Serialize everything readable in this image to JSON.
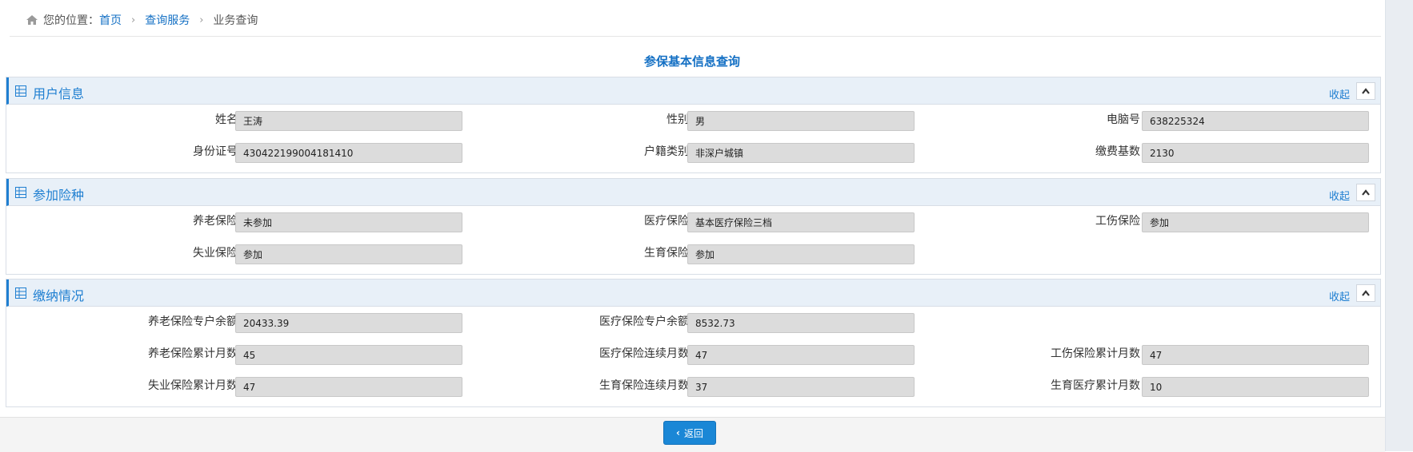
{
  "breadcrumb": {
    "prefix": "您的位置：",
    "home": "首页",
    "service": "查询服务",
    "current": "业务查询"
  },
  "page_title": "参保基本信息查询",
  "panels": {
    "user": {
      "title": "用户信息",
      "collapse": "收起",
      "fields": {
        "name": {
          "label": "姓名",
          "value": "王涛"
        },
        "gender": {
          "label": "性别",
          "value": "男"
        },
        "pc_no": {
          "label": "电脑号",
          "value": "638225324"
        },
        "id_no": {
          "label": "身份证号",
          "value": "430422199004181410"
        },
        "hukou": {
          "label": "户籍类别",
          "value": "非深户城镇"
        },
        "base": {
          "label": "缴费基数",
          "value": "2130"
        }
      }
    },
    "insurance": {
      "title": "参加险种",
      "collapse": "收起",
      "fields": {
        "pension": {
          "label": "养老保险",
          "value": "未参加"
        },
        "medical": {
          "label": "医疗保险",
          "value": "基本医疗保险三档"
        },
        "injury": {
          "label": "工伤保险",
          "value": "参加"
        },
        "unemployment": {
          "label": "失业保险",
          "value": "参加"
        },
        "maternity": {
          "label": "生育保险",
          "value": "参加"
        }
      }
    },
    "payment": {
      "title": "缴纳情况",
      "collapse": "收起",
      "fields": {
        "pension_balance": {
          "label": "养老保险专户余额",
          "value": "20433.39"
        },
        "medical_balance": {
          "label": "医疗保险专户余额",
          "value": "8532.73"
        },
        "pension_months": {
          "label": "养老保险累计月数",
          "value": "45"
        },
        "medical_cont_months": {
          "label": "医疗保险连续月数",
          "value": "47"
        },
        "injury_months": {
          "label": "工伤保险累计月数",
          "value": "47"
        },
        "unemployment_months": {
          "label": "失业保险累计月数",
          "value": "47"
        },
        "maternity_cont_months": {
          "label": "生育保险连续月数",
          "value": "37"
        },
        "maternity_medical_months": {
          "label": "生育医疗累计月数",
          "value": "10"
        }
      }
    }
  },
  "back_button": "返回",
  "colors": {
    "accent": "#1f7fd1",
    "link": "#1470c4",
    "button": "#1a87d6"
  }
}
